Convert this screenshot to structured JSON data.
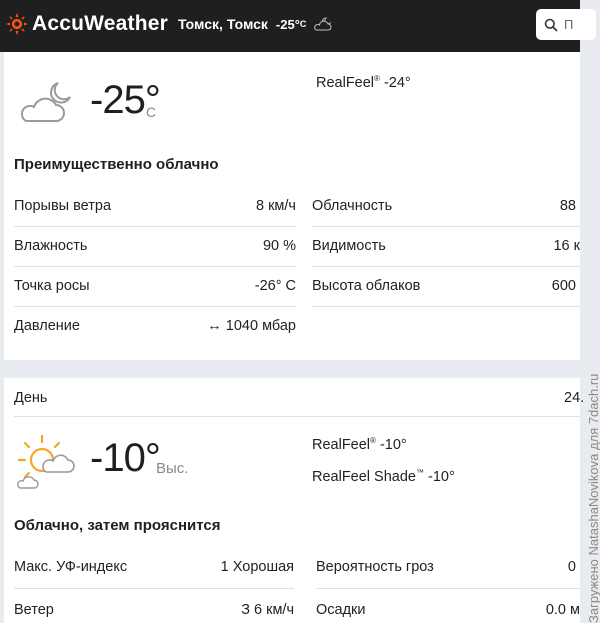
{
  "header": {
    "brand": "AccuWeather",
    "location_city": "Томск,",
    "location_region": "Томск",
    "current_temp": "-25°",
    "current_unit": "C",
    "search_placeholder": "П"
  },
  "current": {
    "temperature": "-25°",
    "unit": "C",
    "realfeel_label": "RealFeel",
    "realfeel_value": "-24°",
    "condition": "Преимущественно облачно",
    "left_details": [
      {
        "label": "Порывы ветра",
        "value": "8 км/ч"
      },
      {
        "label": "Влажность",
        "value": "90 %"
      },
      {
        "label": "Точка росы",
        "value": "-26° C"
      },
      {
        "label": "Давление",
        "value": "↔ 1040 мбар"
      }
    ],
    "right_details": [
      {
        "label": "Облачность",
        "value": "88"
      },
      {
        "label": "Видимость",
        "value": "16 к"
      },
      {
        "label": "Высота облаков",
        "value": "600"
      }
    ]
  },
  "day": {
    "title": "День",
    "date": "24.",
    "temperature": "-10°",
    "hi_label": "Выс.",
    "realfeel_label": "RealFeel",
    "realfeel_value": "-10°",
    "realfeel_shade_label": "RealFeel Shade",
    "realfeel_shade_value": "-10°",
    "condition": "Облачно, затем прояснится",
    "left_details": [
      {
        "label": "Макс. УФ-индекс",
        "value": "1 Хорошая"
      },
      {
        "label": "Ветер",
        "value": "З 6 км/ч"
      }
    ],
    "right_details": [
      {
        "label": "Вероятность гроз",
        "value": "0"
      },
      {
        "label": "Осадки",
        "value": "0.0 м"
      }
    ]
  },
  "watermark": "Загружено NatashaNovikova для 7dach.ru",
  "colors": {
    "brand_orange": "#f05514",
    "topbar": "#1f1f1f",
    "page_bg": "#e8ebef",
    "sun": "#f6a623"
  }
}
